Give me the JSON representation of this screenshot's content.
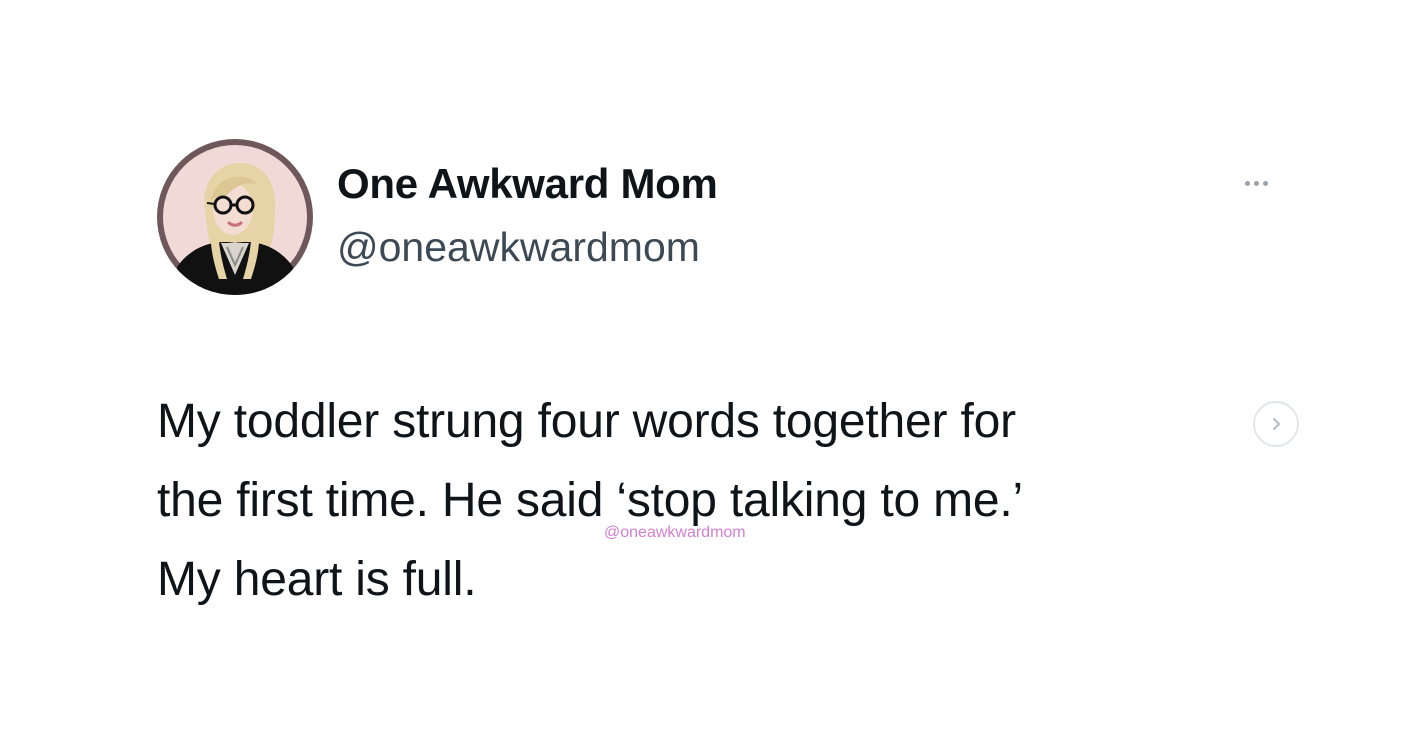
{
  "author": {
    "display_name": "One Awkward Mom",
    "handle": "@oneawkwardmom",
    "avatar_icon": "illustrated-woman-avatar"
  },
  "tweet": {
    "lines": [
      "My toddler strung four words together for",
      "the first time. He said ‘stop talking to me.’",
      "My heart is full."
    ]
  },
  "watermark": "@oneawkwardmom",
  "icons": {
    "more": "more-options-icon",
    "next": "chevron-right-icon"
  },
  "colors": {
    "text": "#0f1419",
    "handle": "#3d4a55",
    "watermark": "#d57fd0",
    "avatar_ring": "#6f585b",
    "avatar_bg": "#f0d9d6"
  }
}
